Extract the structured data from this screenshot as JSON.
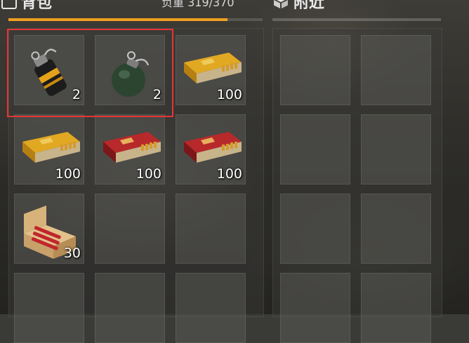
{
  "backpack": {
    "title": "背包",
    "weight_label": "负重",
    "weight_value": "319/370",
    "weight_fraction": 0.862,
    "accent_color": "#f0a020",
    "items": [
      {
        "name": "smoke-grenade",
        "qty": "2"
      },
      {
        "name": "frag-grenade",
        "qty": "2"
      },
      {
        "name": "ammo-box-yellow",
        "qty": "100"
      },
      {
        "name": "ammo-box-yellow",
        "qty": "100"
      },
      {
        "name": "ammo-box-red",
        "qty": "100"
      },
      {
        "name": "ammo-box-red",
        "qty": "100"
      },
      {
        "name": "shotgun-shells-box",
        "qty": "30"
      },
      {
        "name": "empty",
        "qty": ""
      },
      {
        "name": "empty",
        "qty": ""
      },
      {
        "name": "empty",
        "qty": ""
      },
      {
        "name": "empty",
        "qty": ""
      },
      {
        "name": "empty",
        "qty": ""
      }
    ]
  },
  "nearby": {
    "title": "附近"
  },
  "highlight_color": "#e53535"
}
